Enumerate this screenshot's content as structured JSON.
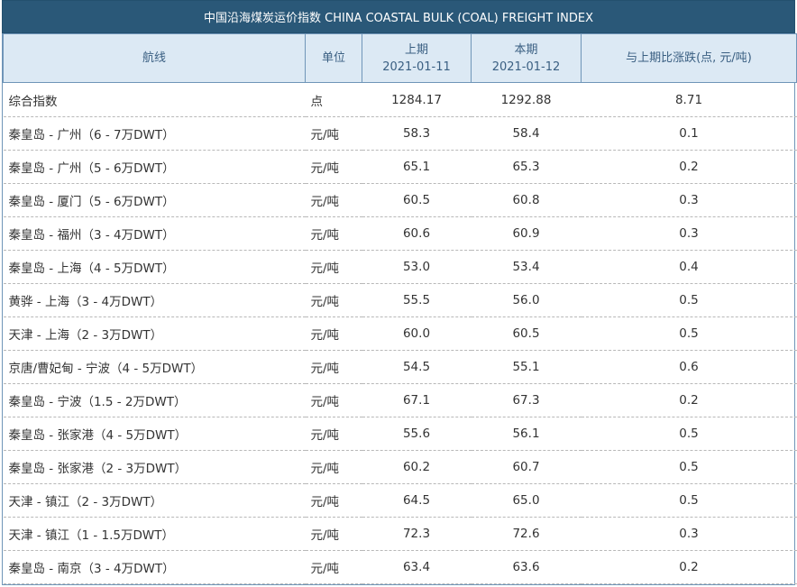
{
  "title": "中国沿海煤炭运价指数 CHINA COASTAL BULK (COAL) FREIGHT INDEX",
  "headers": {
    "route": "航线",
    "unit": "单位",
    "prev_label": "上期",
    "prev_date": "2021-01-11",
    "curr_label": "本期",
    "curr_date": "2021-01-12",
    "change": "与上期比涨跌(点, 元/吨)"
  },
  "rows": [
    {
      "route": "综合指数",
      "unit": "点",
      "prev": "1284.17",
      "curr": "1292.88",
      "change": "8.71"
    },
    {
      "route": "秦皇岛 - 广州（6 - 7万DWT）",
      "unit": "元/吨",
      "prev": "58.3",
      "curr": "58.4",
      "change": "0.1"
    },
    {
      "route": "秦皇岛 - 广州（5 - 6万DWT）",
      "unit": "元/吨",
      "prev": "65.1",
      "curr": "65.3",
      "change": "0.2"
    },
    {
      "route": "秦皇岛 - 厦门（5 - 6万DWT）",
      "unit": "元/吨",
      "prev": "60.5",
      "curr": "60.8",
      "change": "0.3"
    },
    {
      "route": "秦皇岛 - 福州（3 - 4万DWT）",
      "unit": "元/吨",
      "prev": "60.6",
      "curr": "60.9",
      "change": "0.3"
    },
    {
      "route": "秦皇岛 - 上海（4 - 5万DWT）",
      "unit": "元/吨",
      "prev": "53.0",
      "curr": "53.4",
      "change": "0.4"
    },
    {
      "route": "黄骅 - 上海（3 - 4万DWT）",
      "unit": "元/吨",
      "prev": "55.5",
      "curr": "56.0",
      "change": "0.5"
    },
    {
      "route": "天津 - 上海（2 - 3万DWT）",
      "unit": "元/吨",
      "prev": "60.0",
      "curr": "60.5",
      "change": "0.5"
    },
    {
      "route": "京唐/曹妃甸 - 宁波（4 - 5万DWT）",
      "unit": "元/吨",
      "prev": "54.5",
      "curr": "55.1",
      "change": "0.6"
    },
    {
      "route": "秦皇岛 - 宁波（1.5 - 2万DWT）",
      "unit": "元/吨",
      "prev": "67.1",
      "curr": "67.3",
      "change": "0.2"
    },
    {
      "route": "秦皇岛 - 张家港（4 - 5万DWT）",
      "unit": "元/吨",
      "prev": "55.6",
      "curr": "56.1",
      "change": "0.5"
    },
    {
      "route": "秦皇岛 - 张家港（2 - 3万DWT）",
      "unit": "元/吨",
      "prev": "60.2",
      "curr": "60.7",
      "change": "0.5"
    },
    {
      "route": "天津 - 镇江（2 - 3万DWT）",
      "unit": "元/吨",
      "prev": "64.5",
      "curr": "65.0",
      "change": "0.5"
    },
    {
      "route": "天津 - 镇江（1 - 1.5万DWT）",
      "unit": "元/吨",
      "prev": "72.3",
      "curr": "72.6",
      "change": "0.3"
    },
    {
      "route": "秦皇岛 - 南京（3 - 4万DWT）",
      "unit": "元/吨",
      "prev": "63.4",
      "curr": "63.6",
      "change": "0.2"
    }
  ]
}
